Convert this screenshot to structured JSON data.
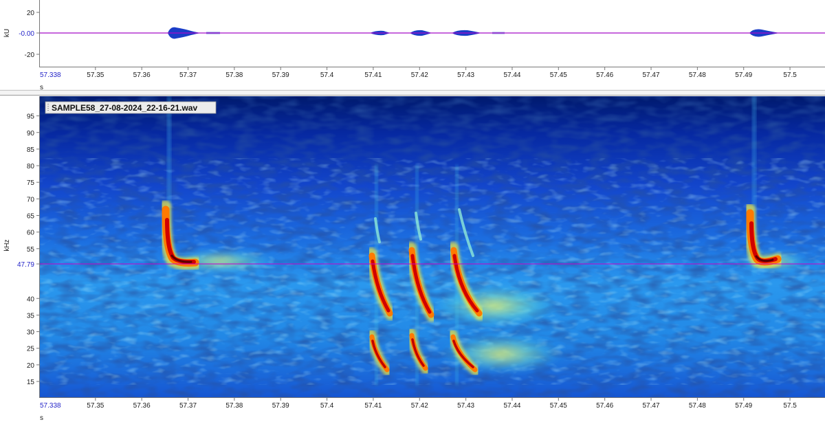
{
  "waveform": {
    "unit_label": "kU",
    "y_ticks": [
      "20",
      "-0.00",
      "-20"
    ],
    "x_unit_label": "s"
  },
  "spectrogram": {
    "file_label": "SAMPLE58_27-08-2024_22-16-21.wav",
    "freq_unit_label": "kHz",
    "freq_ticks": [
      "95",
      "90",
      "85",
      "80",
      "75",
      "70",
      "65",
      "60",
      "55",
      "40",
      "35",
      "30",
      "25",
      "20",
      "15"
    ],
    "marker_freq_label": "47.79",
    "x_unit_label": "s"
  },
  "time_axis": {
    "start_label": "57.338",
    "ticks": [
      "57.35",
      "57.36",
      "57.37",
      "57.38",
      "57.39",
      "57.4",
      "57.41",
      "57.42",
      "57.43",
      "57.44",
      "57.45",
      "57.46",
      "57.47",
      "57.48",
      "57.49",
      "57.5"
    ]
  },
  "colors": {
    "cursor": "#c800c8",
    "highlight_label": "#2323c8",
    "waveform": "#1a3dc8"
  }
}
